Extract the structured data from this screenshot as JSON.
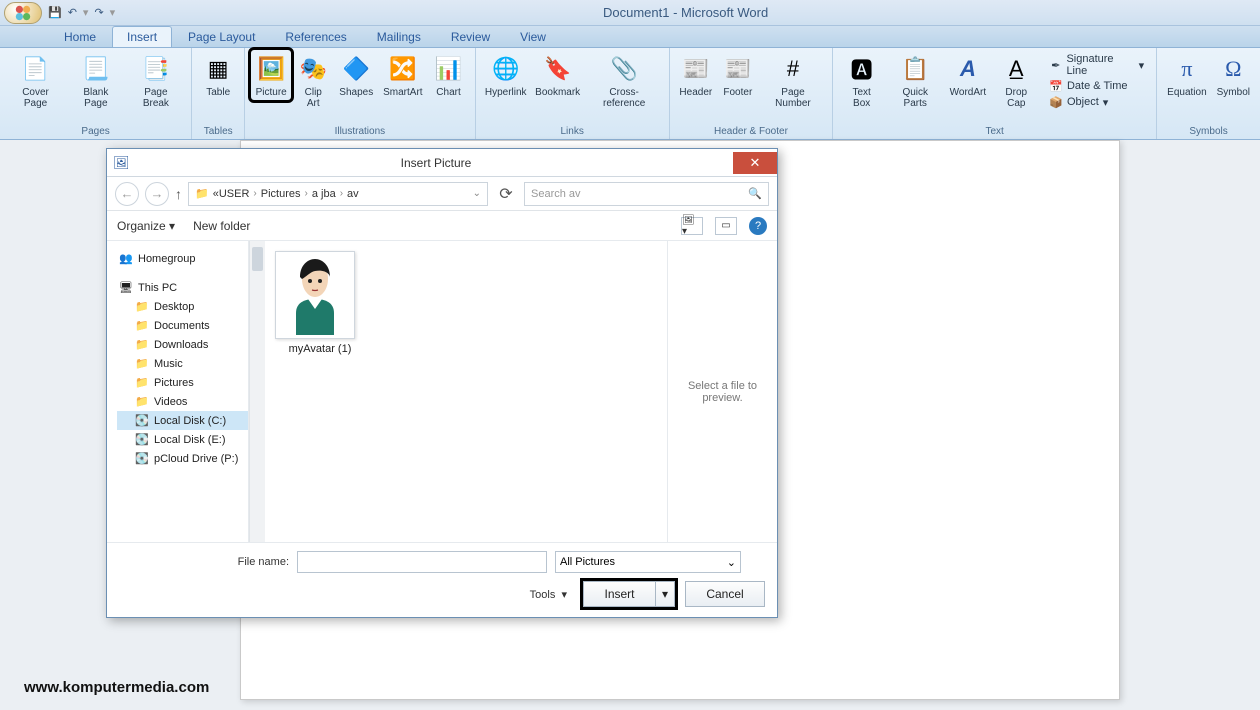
{
  "title": "Document1 - Microsoft Word",
  "tabs": [
    "Home",
    "Insert",
    "Page Layout",
    "References",
    "Mailings",
    "Review",
    "View"
  ],
  "active_tab": "Insert",
  "ribbon": {
    "pages": {
      "label": "Pages",
      "items": [
        "Cover Page",
        "Blank Page",
        "Page Break"
      ]
    },
    "tables": {
      "label": "Tables",
      "items": [
        "Table"
      ]
    },
    "illustrations": {
      "label": "Illustrations",
      "items": [
        "Picture",
        "Clip Art",
        "Shapes",
        "SmartArt",
        "Chart"
      ]
    },
    "links": {
      "label": "Links",
      "items": [
        "Hyperlink",
        "Bookmark",
        "Cross-reference"
      ]
    },
    "headerfooter": {
      "label": "Header & Footer",
      "items": [
        "Header",
        "Footer",
        "Page Number"
      ]
    },
    "text": {
      "label": "Text",
      "items": [
        "Text Box",
        "Quick Parts",
        "WordArt",
        "Drop Cap"
      ],
      "side": [
        "Signature Line",
        "Date & Time",
        "Object"
      ]
    },
    "symbols": {
      "label": "Symbols",
      "items": [
        "Equation",
        "Symbol"
      ]
    }
  },
  "dialog": {
    "title": "Insert Picture",
    "breadcrumb": [
      "USER",
      "Pictures",
      "a jba",
      "av"
    ],
    "breadcrumb_prefix": "«",
    "search_placeholder": "Search av",
    "toolbar": {
      "organize": "Organize",
      "newfolder": "New folder"
    },
    "tree": {
      "homegroup": "Homegroup",
      "thispc": "This PC",
      "children": [
        "Desktop",
        "Documents",
        "Downloads",
        "Music",
        "Pictures",
        "Videos",
        "Local Disk (C:)",
        "Local Disk (E:)",
        "pCloud Drive (P:)"
      ],
      "selected": "Local Disk (C:)"
    },
    "file": {
      "name": "myAvatar (1)"
    },
    "preview_empty": "Select a file to preview.",
    "filename_label": "File name:",
    "filename_value": "",
    "filter": "All Pictures",
    "tools": "Tools",
    "insert": "Insert",
    "cancel": "Cancel"
  },
  "watermark": "www.komputermedia.com"
}
